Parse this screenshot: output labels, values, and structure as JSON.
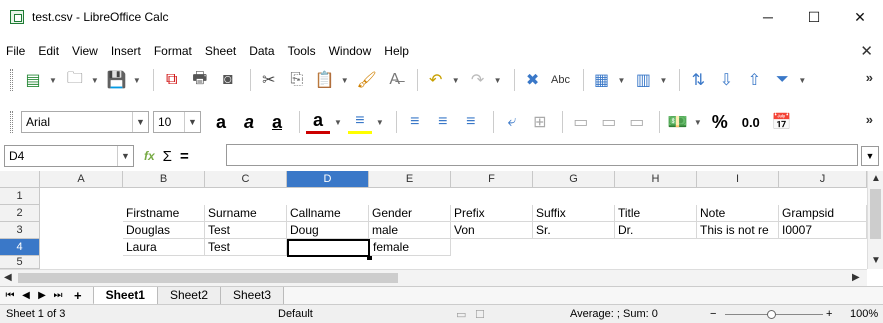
{
  "window": {
    "title": "test.csv - LibreOffice Calc",
    "minimize": "─",
    "maximize": "☐",
    "close": "✕"
  },
  "menu": {
    "items": [
      "File",
      "Edit",
      "View",
      "Insert",
      "Format",
      "Sheet",
      "Data",
      "Tools",
      "Window",
      "Help"
    ],
    "close_doc": "✕"
  },
  "toolbar2": {
    "font_name": "Arial",
    "font_size": "10",
    "number_pct": "%",
    "number_dec": "0.0"
  },
  "toolbar_more": "»",
  "formula": {
    "name_box": "D4",
    "content": ""
  },
  "columns": [
    "A",
    "B",
    "C",
    "D",
    "E",
    "F",
    "G",
    "H",
    "I",
    "J"
  ],
  "rows": [
    "1",
    "2",
    "3",
    "4",
    "5"
  ],
  "cells": {
    "r2": [
      "",
      "Firstname",
      "Surname",
      "Callname",
      "Gender",
      "Prefix",
      "Suffix",
      "Title",
      "Note",
      "Grampsid"
    ],
    "r3": [
      "",
      "Douglas",
      "Test",
      "Doug",
      "male",
      "Von",
      "Sr.",
      "Dr.",
      "This is not re",
      "I0007"
    ],
    "r4": [
      "",
      "Laura",
      "Test",
      "",
      "female",
      "",
      "",
      "",
      "",
      ""
    ]
  },
  "selected_column": "D",
  "selected_row": "4",
  "sheets": [
    "Sheet1",
    "Sheet2",
    "Sheet3"
  ],
  "active_sheet": "Sheet1",
  "status": {
    "sheet_info": "Sheet 1 of 3",
    "page_style": "Default",
    "aggregate": "Average: ; Sum: 0",
    "zoom": "100%"
  }
}
